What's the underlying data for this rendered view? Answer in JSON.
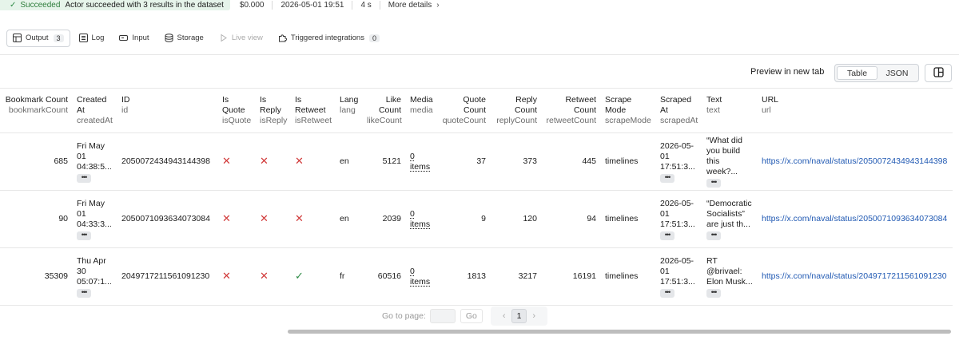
{
  "status_bar": {
    "status_label": "Succeeded",
    "status_message": "Actor succeeded with 3 results in the dataset",
    "cost": "$0.000",
    "finished_at": "2026-05-01 19:51",
    "duration": "4 s",
    "more_details": "More details"
  },
  "tabs": [
    {
      "label": "Output",
      "count": "3"
    },
    {
      "label": "Log"
    },
    {
      "label": "Input"
    },
    {
      "label": "Storage"
    },
    {
      "label": "Live view"
    },
    {
      "label": "Triggered integrations",
      "count": "0"
    }
  ],
  "toolbar": {
    "preview_label": "Preview in new tab",
    "view_table": "Table",
    "view_json": "JSON"
  },
  "columns": [
    {
      "label": "Bookmark Count",
      "key": "bookmarkCount"
    },
    {
      "label": "Created At",
      "key": "createdAt"
    },
    {
      "label": "ID",
      "key": "id"
    },
    {
      "label": "Is Quote",
      "key": "isQuote"
    },
    {
      "label": "Is Reply",
      "key": "isReply"
    },
    {
      "label": "Is Retweet",
      "key": "isRetweet"
    },
    {
      "label": "Lang",
      "key": "lang"
    },
    {
      "label": "Like Count",
      "key": "likeCount"
    },
    {
      "label": "Media",
      "key": "media"
    },
    {
      "label": "Quote Count",
      "key": "quoteCount"
    },
    {
      "label": "Reply Count",
      "key": "replyCount"
    },
    {
      "label": "Retweet Count",
      "key": "retweetCount"
    },
    {
      "label": "Scrape Mode",
      "key": "scrapeMode"
    },
    {
      "label": "Scraped At",
      "key": "scrapedAt"
    },
    {
      "label": "Text",
      "key": "text"
    },
    {
      "label": "URL",
      "key": "url"
    }
  ],
  "rows": [
    {
      "bookmarkCount": "685",
      "createdAt": "Fri May 01 04:38:5...",
      "id": "2050072434943144398",
      "isQuote": false,
      "isReply": false,
      "isRetweet": false,
      "lang": "en",
      "likeCount": "5121",
      "media": "0 items",
      "quoteCount": "37",
      "replyCount": "373",
      "retweetCount": "445",
      "scrapeMode": "timelines",
      "scrapedAt": "2026-05-01 17:51:3...",
      "text": "“What did you build this week?...",
      "url": "https://x.com/naval/status/2050072434943144398"
    },
    {
      "bookmarkCount": "90",
      "createdAt": "Fri May 01 04:33:3...",
      "id": "2050071093634073084",
      "isQuote": false,
      "isReply": false,
      "isRetweet": false,
      "lang": "en",
      "likeCount": "2039",
      "media": "0 items",
      "quoteCount": "9",
      "replyCount": "120",
      "retweetCount": "94",
      "scrapeMode": "timelines",
      "scrapedAt": "2026-05-01 17:51:3...",
      "text": "“Democratic Socialists” are just th...",
      "url": "https://x.com/naval/status/2050071093634073084"
    },
    {
      "bookmarkCount": "35309",
      "createdAt": "Thu Apr 30 05:07:1...",
      "id": "2049717211561091230",
      "isQuote": false,
      "isReply": false,
      "isRetweet": true,
      "lang": "fr",
      "likeCount": "60516",
      "media": "0 items",
      "quoteCount": "1813",
      "replyCount": "3217",
      "retweetCount": "16191",
      "scrapeMode": "timelines",
      "scrapedAt": "2026-05-01 17:51:3...",
      "text": "RT @brivael: Elon Musk...",
      "url": "https://x.com/naval/status/2049717211561091230"
    }
  ],
  "pagination": {
    "goto_label": "Go to page:",
    "go_label": "Go",
    "current_page": "1"
  },
  "colors": {
    "success_bg": "#e6f4ea",
    "success_text": "#2e7d3c",
    "cross": "#d13a3a",
    "check": "#2e8b46",
    "link": "#2059b3"
  }
}
